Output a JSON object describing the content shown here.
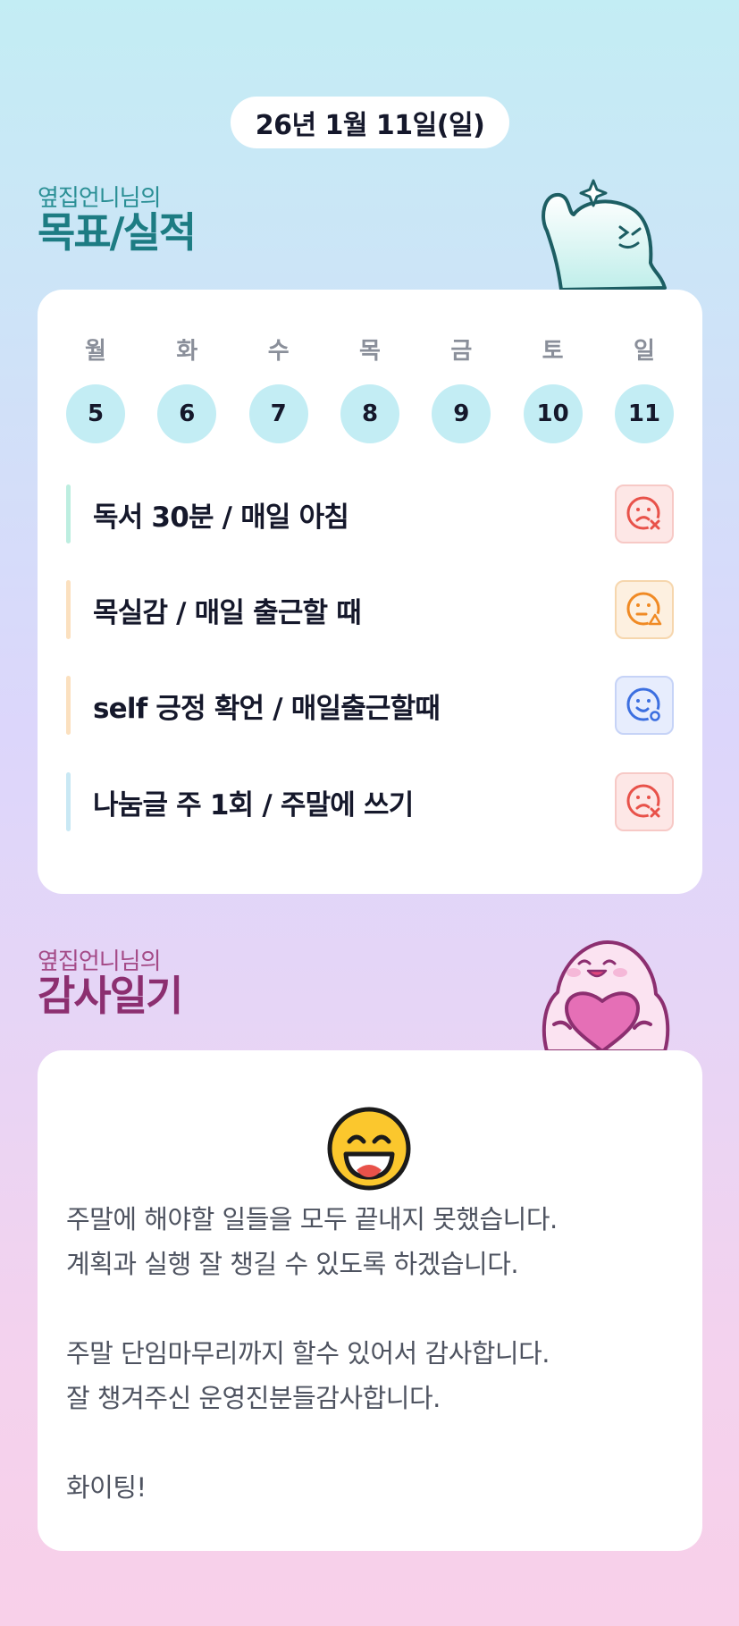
{
  "date_label": "26년 1월 11일(일)",
  "goals_section": {
    "subtitle": "옆집언니님의",
    "title": "목표/실적"
  },
  "week": [
    {
      "day": "월",
      "date": "5"
    },
    {
      "day": "화",
      "date": "6"
    },
    {
      "day": "수",
      "date": "7"
    },
    {
      "day": "목",
      "date": "8"
    },
    {
      "day": "금",
      "date": "9"
    },
    {
      "day": "토",
      "date": "10"
    },
    {
      "day": "일",
      "date": "11"
    }
  ],
  "goals": [
    {
      "text": "독서 30분 / 매일 아침",
      "status": "fail",
      "status_icon": "sad-x-face-icon",
      "bar_color": "#bdeee0"
    },
    {
      "text": "목실감 / 매일 출근할 때",
      "status": "partial",
      "status_icon": "neutral-triangle-face-icon",
      "bar_color": "#fbe0bf"
    },
    {
      "text": "self 긍정 확언 / 매일출근할때",
      "status": "success",
      "status_icon": "smile-circle-face-icon",
      "bar_color": "#fbe0bf"
    },
    {
      "text": "나눔글 주 1회 / 주말에 쓰기",
      "status": "fail",
      "status_icon": "sad-x-face-icon",
      "bar_color": "#c9e8f4"
    }
  ],
  "status_colors": {
    "fail": "#e8524a",
    "partial": "#f08a24",
    "success": "#3c6fe0"
  },
  "gratitude_section": {
    "subtitle": "옆집언니님의",
    "title": "감사일기"
  },
  "diary": {
    "mood_icon": "grinning-face-icon",
    "lines": [
      "주말에 해야할 일들을 모두 끝내지 못했습니다.",
      "계획과 실행 잘 챙길 수 있도록 하겠습니다.",
      "",
      "주말 단임마무리까지 할수 있어서 감사합니다.",
      "잘 챙겨주신 운영진분들감사합니다.",
      "",
      "화이팅!"
    ]
  }
}
